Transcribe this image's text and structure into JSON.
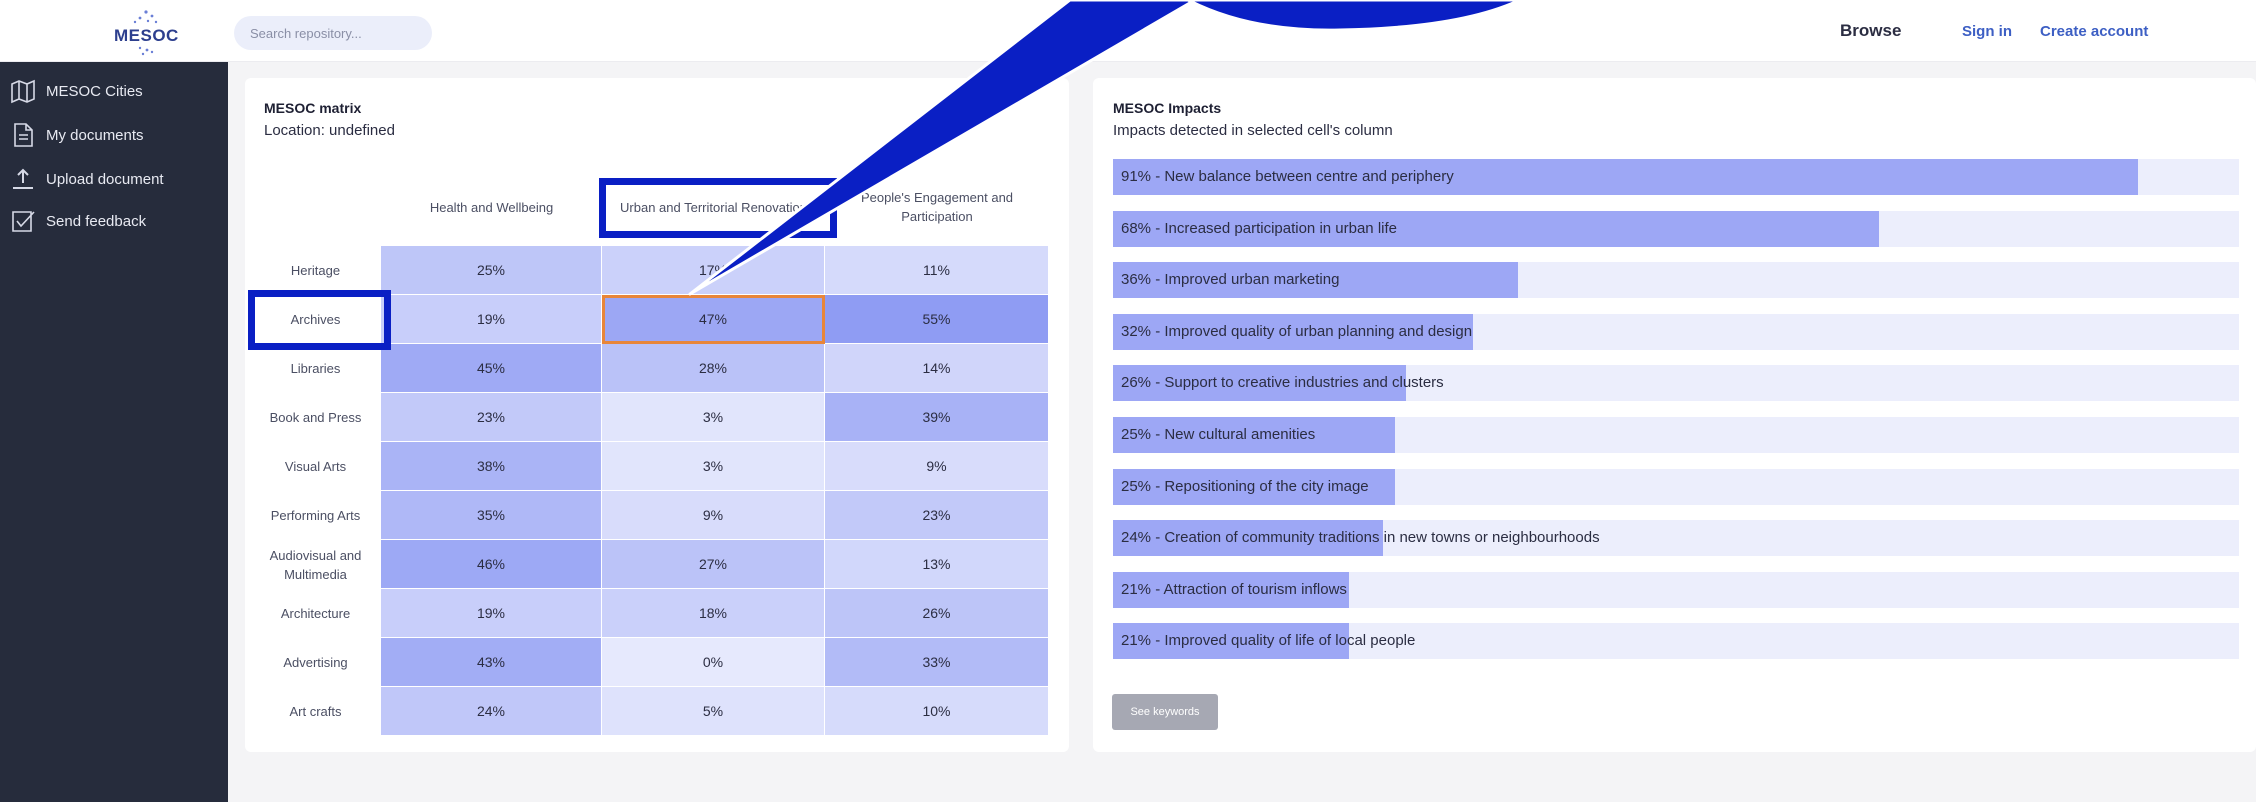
{
  "header": {
    "logo_text": "MESOC",
    "search_placeholder": "Search repository...",
    "nav": {
      "browse": "Browse",
      "sign_in": "Sign in",
      "create_account": "Create account"
    }
  },
  "sidebar": {
    "items": [
      {
        "label": "MESOC Cities",
        "icon": "map-icon"
      },
      {
        "label": "My documents",
        "icon": "document-icon"
      },
      {
        "label": "Upload document",
        "icon": "upload-icon"
      },
      {
        "label": "Send feedback",
        "icon": "checkbox-icon"
      }
    ]
  },
  "matrix": {
    "title": "MESOC matrix",
    "location": "Location: undefined",
    "columns": [
      "Health and Wellbeing",
      "Urban and Territorial Renovation",
      "People's Engagement and Participation"
    ],
    "rows": [
      {
        "label": "Heritage",
        "values": [
          "25%",
          "17%",
          "11%"
        ]
      },
      {
        "label": "Archives",
        "values": [
          "19%",
          "47%",
          "55%"
        ]
      },
      {
        "label": "Libraries",
        "values": [
          "45%",
          "28%",
          "14%"
        ]
      },
      {
        "label": "Book and Press",
        "values": [
          "23%",
          "3%",
          "39%"
        ]
      },
      {
        "label": "Visual Arts",
        "values": [
          "38%",
          "3%",
          "9%"
        ]
      },
      {
        "label": "Performing Arts",
        "values": [
          "35%",
          "9%",
          "23%"
        ]
      },
      {
        "label": "Audiovisual and Multimedia",
        "values": [
          "46%",
          "27%",
          "13%"
        ]
      },
      {
        "label": "Architecture",
        "values": [
          "19%",
          "18%",
          "26%"
        ]
      },
      {
        "label": "Advertising",
        "values": [
          "43%",
          "0%",
          "33%"
        ]
      },
      {
        "label": "Art crafts",
        "values": [
          "24%",
          "5%",
          "10%"
        ]
      }
    ],
    "selected_cell": {
      "row": "Archives",
      "column": "Urban and Territorial Renovation"
    },
    "colors": {
      "low": "#e6e9fd",
      "high": "#8f9cf3",
      "selected_outline": "#e8863a"
    }
  },
  "impacts": {
    "title": "MESOC Impacts",
    "subtitle": "Impacts detected in selected cell's column",
    "items": [
      {
        "label": "91% - New balance between centre and periphery",
        "value": 91
      },
      {
        "label": "68% - Increased participation in urban life",
        "value": 68
      },
      {
        "label": "36% - Improved urban marketing",
        "value": 36
      },
      {
        "label": "32% - Improved quality of urban planning and design",
        "value": 32
      },
      {
        "label": "26% - Support to creative industries and clusters",
        "value": 26
      },
      {
        "label": "25% - New cultural amenities",
        "value": 25
      },
      {
        "label": "25% - Repositioning of the city image",
        "value": 25
      },
      {
        "label": "24% - Creation of community traditions in new towns or neighbourhoods",
        "value": 24
      },
      {
        "label": "21% - Attraction of tourism inflows",
        "value": 21
      },
      {
        "label": "21% - Improved quality of life of local people",
        "value": 21
      }
    ],
    "see_keywords": "See keywords"
  },
  "annotation_color": "#0a1fc4"
}
